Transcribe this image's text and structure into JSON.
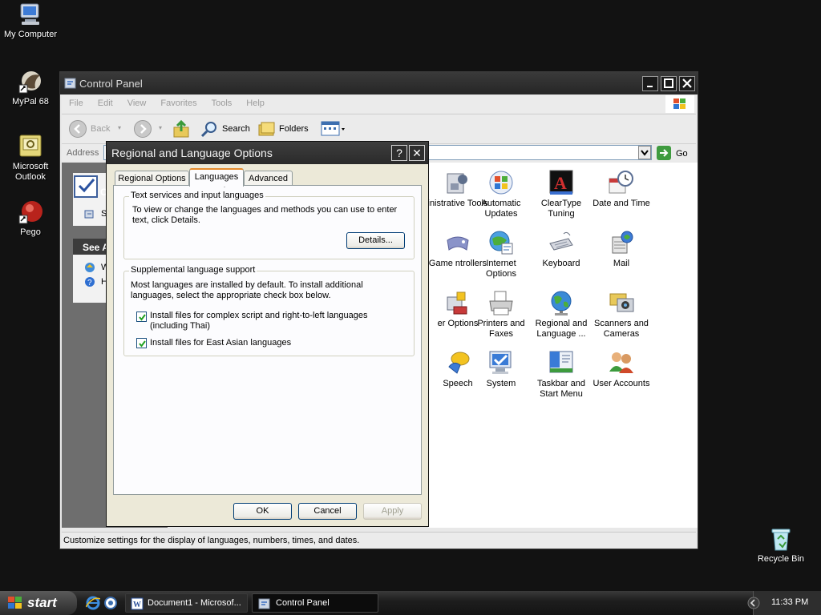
{
  "desktop": {
    "icons": [
      {
        "label": "My Computer"
      },
      {
        "label": "MyPal 68"
      },
      {
        "label": "Microsoft Outlook"
      },
      {
        "label": "Pego"
      },
      {
        "label": "Recycle Bin"
      }
    ]
  },
  "control_panel": {
    "title": "Control Panel",
    "menu": [
      "File",
      "Edit",
      "View",
      "Favorites",
      "Tools",
      "Help"
    ],
    "toolbar": {
      "back": "Back",
      "search": "Search",
      "folders": "Folders"
    },
    "address_label": "Address",
    "go_label": "Go",
    "left_pane": {
      "see_also_prefix": "See A",
      "c_prefix": "C",
      "s_prefix": "S",
      "w_prefix": "W",
      "h_prefix": "H"
    },
    "items": [
      {
        "label": "inistrative Tools"
      },
      {
        "label": "Automatic Updates"
      },
      {
        "label": "ClearType Tuning"
      },
      {
        "label": "Date and Time"
      },
      {
        "label": "Game ntrollers"
      },
      {
        "label": "Internet Options"
      },
      {
        "label": "Keyboard"
      },
      {
        "label": "Mail"
      },
      {
        "label": "er Options"
      },
      {
        "label": "Printers and Faxes"
      },
      {
        "label": "Regional and Language ..."
      },
      {
        "label": "Scanners and Cameras"
      },
      {
        "label": "Speech"
      },
      {
        "label": "System"
      },
      {
        "label": "Taskbar and Start Menu"
      },
      {
        "label": "User Accounts"
      }
    ],
    "status_text": "Customize settings for the display of languages, numbers, times, and dates."
  },
  "dialog": {
    "title": "Regional and Language Options",
    "help_glyph": "?",
    "close_glyph": "✕",
    "tabs": [
      {
        "label": "Regional Options",
        "active": false
      },
      {
        "label": "Languages",
        "active": true
      },
      {
        "label": "Advanced",
        "active": false
      }
    ],
    "text_services": {
      "legend": "Text services and input languages",
      "description": "To view or change the languages and methods you can use to enter text, click Details.",
      "details_button": "Details..."
    },
    "supplemental": {
      "legend": "Supplemental language support",
      "description": "Most languages are installed by default. To install additional languages, select the appropriate check box below.",
      "checkboxes": [
        {
          "label": "Install files for complex script and right-to-left languages (including Thai)",
          "checked": true
        },
        {
          "label": "Install files for East Asian languages",
          "checked": true
        }
      ]
    },
    "buttons": {
      "ok": "OK",
      "cancel": "Cancel",
      "apply": "Apply"
    }
  },
  "taskbar": {
    "start_label": "start",
    "tasks": [
      {
        "label": "Document1 - Microsof...",
        "active": false
      },
      {
        "label": "Control Panel",
        "active": true
      }
    ],
    "clock": "11:33 PM"
  }
}
